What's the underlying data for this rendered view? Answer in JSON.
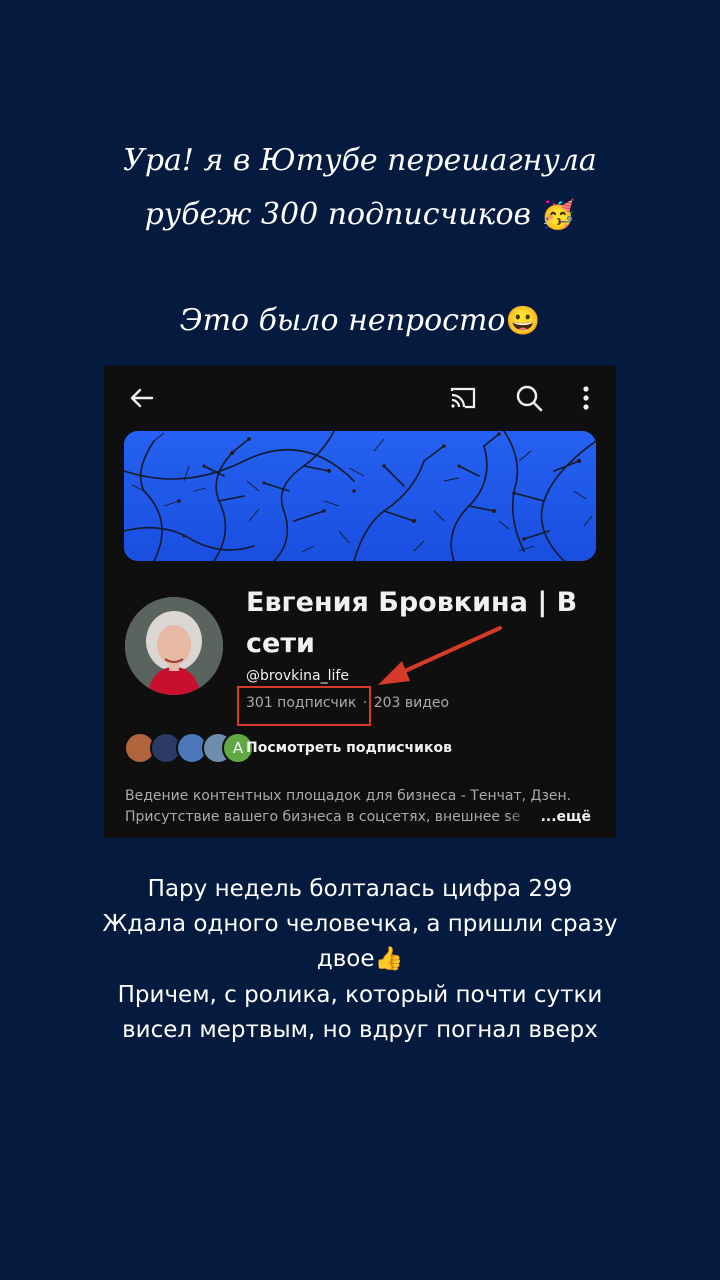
{
  "story": {
    "headline_line1": "Ура! я в Ютубе перешагнула",
    "headline_line2": "рубеж 300 подписчиков",
    "headline_line2_emoji": "🥳",
    "subhead": "Это было непросто",
    "subhead_emoji": "😀",
    "body_line1": "Пару недель болталась цифра 299",
    "body_line2": "Ждала одного человечка, а пришли сразу",
    "body_line3": "двое",
    "body_line3_emoji": "👍",
    "body_line4": "Причем, с ролика, который почти сутки",
    "body_line5": "висел мертвым, но вдруг погнал вверх"
  },
  "youtube": {
    "channel_name": "Евгения Бровкина | В сети",
    "handle": "@brovkina_life",
    "subscribers": "301 подписчик",
    "separator": "·",
    "videos": "203 видео",
    "view_subscribers": "Посмотреть подписчиков",
    "last_avatar_letter": "А",
    "description_line1": "Ведение контентных площадок для бизнеса - Тенчат, Дзен.",
    "description_line2": "Присутствие вашего бизнеса в соцсетях, внешнее se",
    "more": "...ещё"
  },
  "icons": {
    "back": "arrow-left-icon",
    "cast": "cast-icon",
    "search": "search-icon",
    "menu": "more-vertical-icon"
  },
  "colors": {
    "page_background": "#041b3f",
    "app_background": "#0f0f0f",
    "banner_sky": "#1f57ea",
    "highlight_red": "#d63b2a"
  }
}
